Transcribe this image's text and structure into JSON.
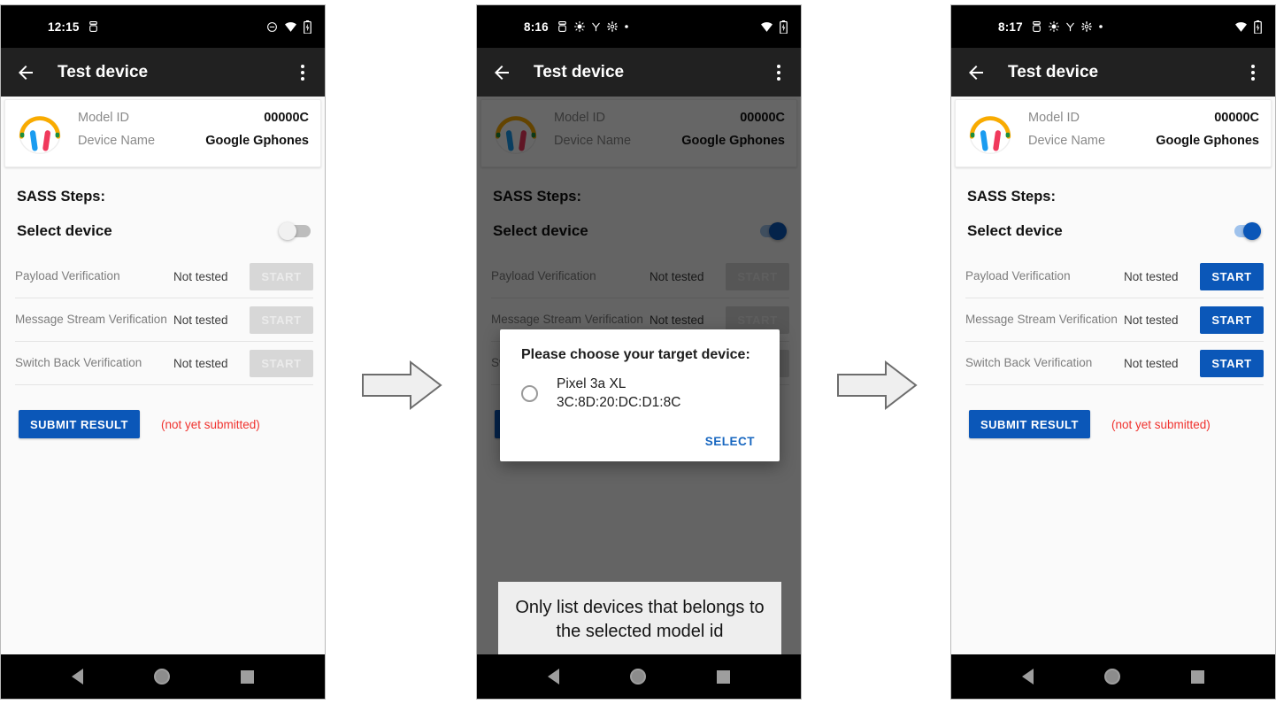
{
  "app": {
    "title": "Test device",
    "accent_blue": "#0b57b8",
    "link_blue": "#1867c0",
    "error_red": "#f0322e",
    "disabled_gray": "#d7d7d7",
    "scrim": "rgba(0,0,0,0.60)"
  },
  "icons": {
    "back_arrow": "back-arrow-icon",
    "overflow": "overflow-menu-icon",
    "buds": "pixel-buds-icon",
    "wifi": "wifi-icon",
    "battery": "battery-icon",
    "dnd": "do-not-disturb-icon",
    "android_debug": "android-debug-icon",
    "brightness": "brightness-icon",
    "vpn": "vpn-icon",
    "settings": "settings-gear-icon",
    "more_dot": "more-dot-icon",
    "nav_back": "nav-back-triangle-icon",
    "nav_home": "nav-home-circle-icon",
    "nav_recent": "nav-recents-square-icon",
    "flow_arrow": "flow-arrow-icon"
  },
  "device_card": {
    "rows": [
      {
        "key": "Model ID",
        "value": "00000C"
      },
      {
        "key": "Device Name",
        "value": "Google Gphones"
      }
    ]
  },
  "labels": {
    "section_title": "SASS Steps:",
    "select_device": "Select device",
    "submit_button": "SUBMIT RESULT",
    "submit_note": "(not yet submitted)",
    "start_button": "START",
    "status_not_tested": "Not tested"
  },
  "steps": [
    {
      "name": "Payload Verification",
      "status": "Not tested",
      "action": "START"
    },
    {
      "name": "Message Stream Verification",
      "status": "Not tested",
      "action": "START"
    },
    {
      "name": "Switch Back Verification",
      "status": "Not tested",
      "action": "START"
    }
  ],
  "panels": [
    {
      "id": "panel-1",
      "status_time": "12:15",
      "status_icons": [
        "android-debug-icon"
      ],
      "status_right": [
        "do-not-disturb-icon",
        "wifi-icon",
        "battery-icon"
      ],
      "toggle_on": false,
      "steps_enabled": false,
      "dimmed": false,
      "dialog_visible": false,
      "callout_visible": false
    },
    {
      "id": "panel-2",
      "status_time": "8:16",
      "status_icons": [
        "android-debug-icon",
        "brightness-icon",
        "vpn-icon",
        "settings-gear-icon",
        "more-dot-icon"
      ],
      "status_right": [
        "wifi-icon",
        "battery-icon"
      ],
      "toggle_on": true,
      "steps_enabled": false,
      "dimmed": true,
      "dialog_visible": true,
      "callout_visible": true
    },
    {
      "id": "panel-3",
      "status_time": "8:17",
      "status_icons": [
        "android-debug-icon",
        "brightness-icon",
        "vpn-icon",
        "settings-gear-icon",
        "more-dot-icon"
      ],
      "status_right": [
        "wifi-icon",
        "battery-icon"
      ],
      "toggle_on": true,
      "steps_enabled": true,
      "dimmed": false,
      "dialog_visible": false,
      "callout_visible": false
    }
  ],
  "dialog": {
    "title": "Please choose your target device:",
    "option_name": "Pixel 3a XL",
    "option_mac": "3C:8D:20:DC:D1:8C",
    "select_label": "SELECT",
    "radio_selected": false
  },
  "callout": {
    "text": "Only list devices that belongs to the selected model id"
  }
}
